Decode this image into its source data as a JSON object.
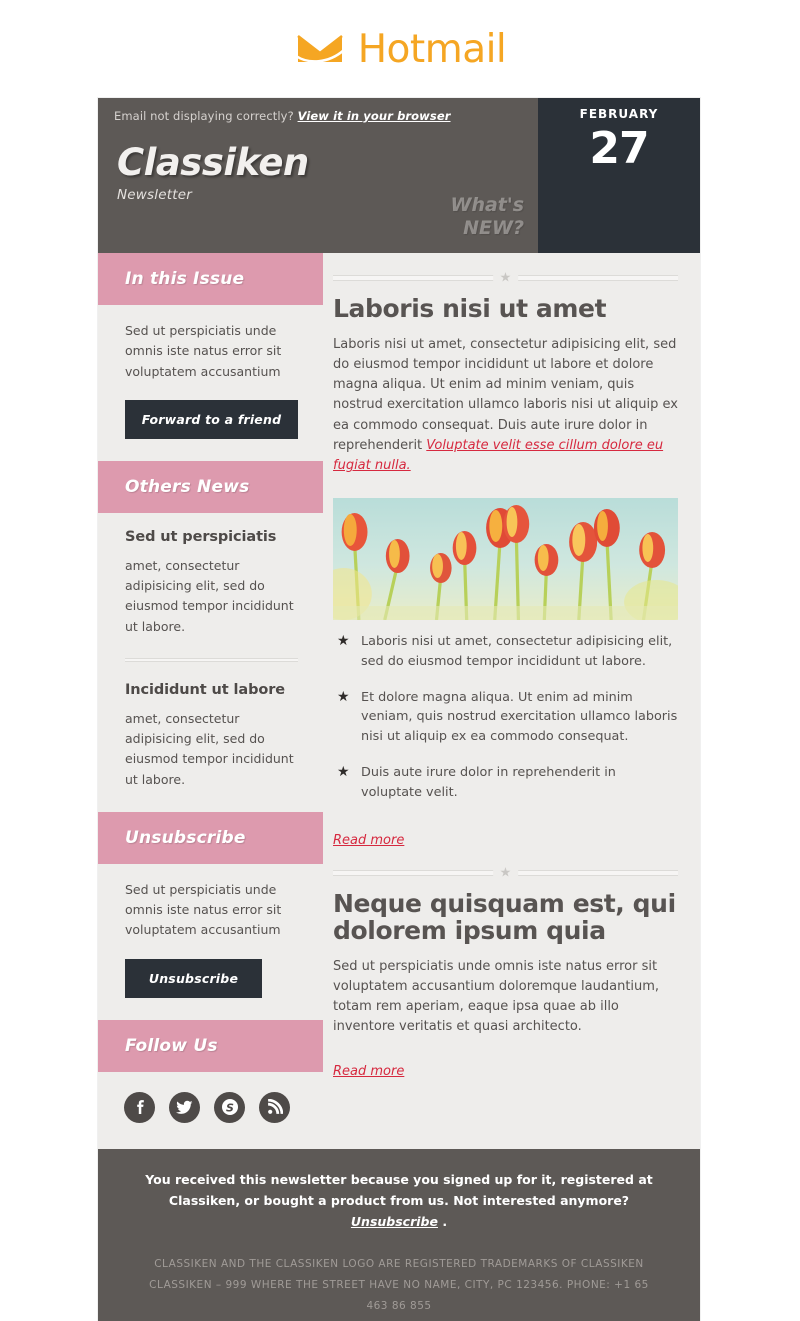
{
  "brand": {
    "name": "Hotmail",
    "logo_icon": "envelope-icon",
    "accent_color": "#f5a623"
  },
  "newsletter": {
    "preheader": {
      "text": "Email not displaying correctly?",
      "link_label": "View it in your browser"
    },
    "masthead": {
      "title": "Classiken",
      "subtitle": "Newsletter",
      "tagline_line1": "What's",
      "tagline_line2": "NEW?"
    },
    "date": {
      "month": "FEBRUARY",
      "day": "27"
    },
    "sidebar": {
      "in_this_issue": {
        "heading": "In this Issue",
        "text": "Sed ut perspiciatis unde omnis iste natus error sit voluptatem accusantium",
        "button_label": "Forward to a friend"
      },
      "others_news": {
        "heading": "Others News",
        "items": [
          {
            "title": "Sed ut perspiciatis",
            "text": "amet, consectetur adipisicing elit, sed do eiusmod tempor incididunt ut labore."
          },
          {
            "title": "Incididunt ut labore",
            "text": "amet, consectetur adipisicing elit, sed do eiusmod tempor incididunt ut labore."
          }
        ]
      },
      "unsubscribe": {
        "heading": "Unsubscribe",
        "text": "Sed ut perspiciatis unde omnis iste natus error sit voluptatem accusantium",
        "button_label": "Unsubscribe"
      },
      "follow_us": {
        "heading": "Follow Us",
        "socials": [
          {
            "name": "facebook-icon",
            "glyph": "f"
          },
          {
            "name": "twitter-icon",
            "glyph": "t"
          },
          {
            "name": "skype-icon",
            "glyph": "S"
          },
          {
            "name": "rss-icon",
            "glyph": "rss"
          }
        ]
      }
    },
    "articles": [
      {
        "title": "Laboris nisi ut amet",
        "body_before_link": "Laboris nisi ut amet, consectetur adipisicing elit, sed do eiusmod tempor incididunt ut labore et dolore magna aliqua. Ut enim ad minim veniam, quis nostrud exercitation ullamco laboris nisi ut aliquip ex ea commodo consequat. Duis aute irure dolor in reprehenderit ",
        "body_link": "Voluptate velit esse cillum dolore eu fugiat nulla.",
        "image_alt": "red and orange tulips against a pale blue sky",
        "bullets": [
          "Laboris nisi ut amet, consectetur adipisicing elit, sed do eiusmod tempor incididunt ut labore.",
          "Et dolore magna aliqua. Ut enim ad minim veniam, quis nostrud exercitation ullamco laboris nisi ut aliquip ex ea commodo consequat.",
          "Duis aute irure dolor in reprehenderit in voluptate velit."
        ],
        "read_more": "Read more"
      },
      {
        "title": "Neque quisquam est, qui dolorem ipsum quia",
        "body": "Sed ut perspiciatis unde omnis iste natus error sit voluptatem accusantium doloremque laudantium, totam rem aperiam, eaque ipsa quae ab illo inventore veritatis et quasi architecto.",
        "read_more": "Read more"
      }
    ],
    "footer": {
      "main_before_link": "You received this newsletter because you signed up for it, registered at Classiken, or bought a product from us. Not interested anymore? ",
      "main_link": "Unsubscribe",
      "main_after_link": " .",
      "legal_line1": "CLASSIKEN AND THE CLASSIKEN LOGO ARE REGISTERED TRADEMARKS OF CLASSIKEN",
      "legal_line2": "CLASSIKEN – 999 WHERE THE STREET HAVE NO NAME, CITY, PC 123456. PHONE: +1 65 463 86 855"
    },
    "colors": {
      "pink": "#dd9aae",
      "dark_gray": "#5d5956",
      "slate": "#2b3138",
      "link_red": "#d6293f",
      "content_bg": "#eeedeb"
    }
  }
}
